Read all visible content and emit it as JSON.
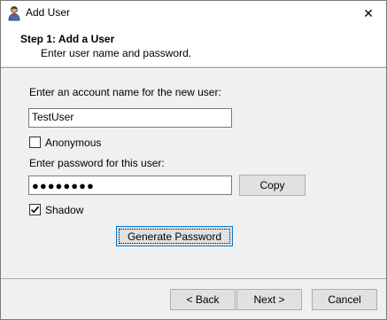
{
  "window": {
    "title": "Add User",
    "close_glyph": "✕",
    "icon": "user-icon"
  },
  "header": {
    "step_title": "Step 1: Add a User",
    "step_subtitle": "Enter user name and password."
  },
  "form": {
    "account_label": "Enter an account name for the new user:",
    "account_value": "TestUser",
    "anonymous_label": "Anonymous",
    "anonymous_checked": false,
    "password_label": "Enter password for this user:",
    "password_masked": "●●●●●●●●",
    "copy_label": "Copy",
    "shadow_label": "Shadow",
    "shadow_checked": true,
    "generate_label": "Generate Password"
  },
  "footer": {
    "back_label": "< Back",
    "next_label": "Next >",
    "cancel_label": "Cancel"
  },
  "colors": {
    "dialog_bg": "#f0f0f0",
    "focus_border": "#0078d7"
  }
}
